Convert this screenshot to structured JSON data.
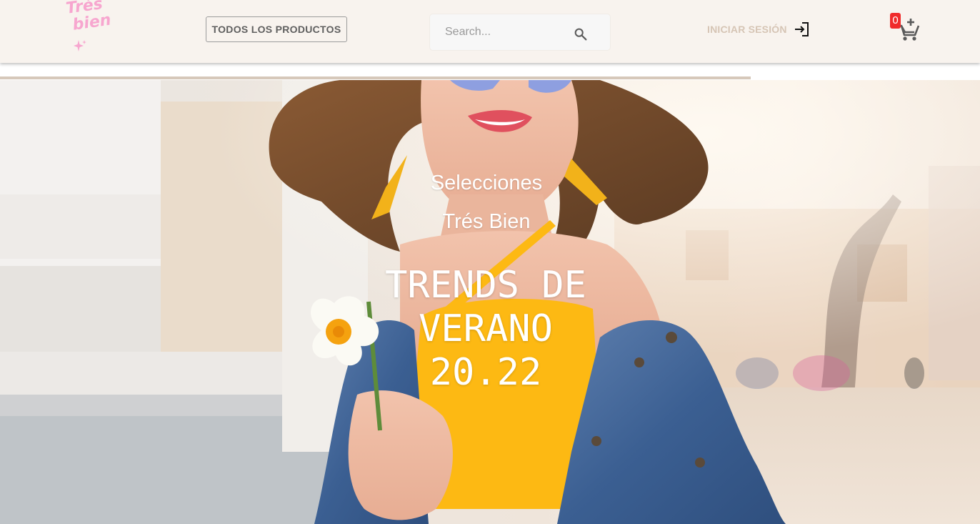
{
  "header": {
    "logo_text_line1": "Trés",
    "logo_text_line2": "bien",
    "all_products_label": "TODOS LOS PRODUCTOS",
    "search": {
      "placeholder": "Search...",
      "value": "",
      "icon": "search-icon"
    },
    "login_label": "INICIAR SESIÓN",
    "login_icon": "login-icon",
    "cart": {
      "count": "0",
      "icon": "add-shopping-cart-icon"
    }
  },
  "scroll_progress": 0.766,
  "hero": {
    "kicker_line1": "Selecciones",
    "kicker_line2": "Trés Bien",
    "headline_line1": "TRENDS DE",
    "headline_line2": "VERANO",
    "headline_line3": "20.22"
  },
  "colors": {
    "header_bg": "#f8f3ee",
    "logo_pink": "#f7a6cf",
    "login_text": "#d6c5b5",
    "badge_red": "#f02b2b",
    "progress": "#d6c8ba",
    "dress_yellow": "#fdb913"
  }
}
